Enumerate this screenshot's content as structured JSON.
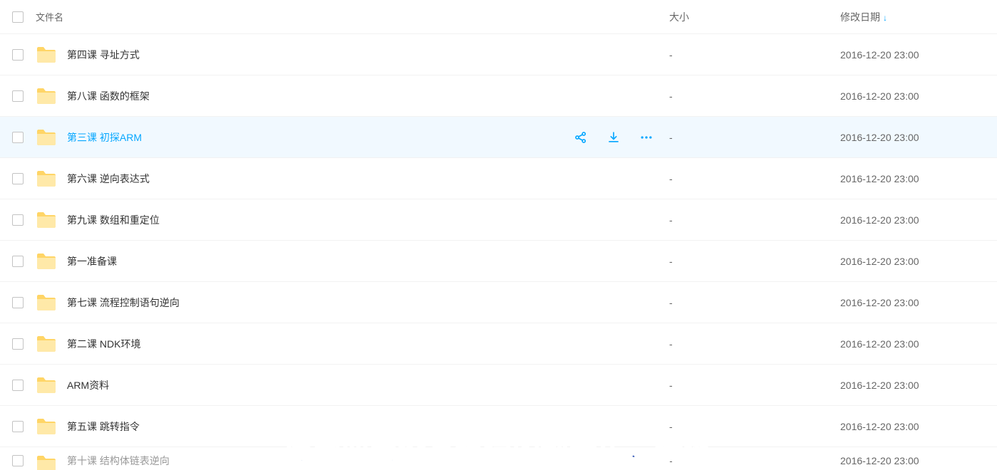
{
  "headers": {
    "name": "文件名",
    "size": "大小",
    "date": "修改日期"
  },
  "overlay_text": "此歌曲为没有填词的纯音乐，请您",
  "hovered_index": 2,
  "files": [
    {
      "name": "第四课 寻址方式",
      "size": "-",
      "date": "2016-12-20 23:00"
    },
    {
      "name": "第八课 函数的框架",
      "size": "-",
      "date": "2016-12-20 23:00"
    },
    {
      "name": "第三课 初探ARM",
      "size": "-",
      "date": "2016-12-20 23:00"
    },
    {
      "name": "第六课 逆向表达式",
      "size": "-",
      "date": "2016-12-20 23:00"
    },
    {
      "name": "第九课 数组和重定位",
      "size": "-",
      "date": "2016-12-20 23:00"
    },
    {
      "name": "第一准备课",
      "size": "-",
      "date": "2016-12-20 23:00"
    },
    {
      "name": "第七课 流程控制语句逆向",
      "size": "-",
      "date": "2016-12-20 23:00"
    },
    {
      "name": "第二课 NDK环境",
      "size": "-",
      "date": "2016-12-20 23:00"
    },
    {
      "name": "ARM资料",
      "size": "-",
      "date": "2016-12-20 23:00"
    },
    {
      "name": "第五课 跳转指令",
      "size": "-",
      "date": "2016-12-20 23:00"
    },
    {
      "name": "第十课 结构体链表逆向",
      "size": "-",
      "date": "2016-12-20 23:00"
    }
  ]
}
